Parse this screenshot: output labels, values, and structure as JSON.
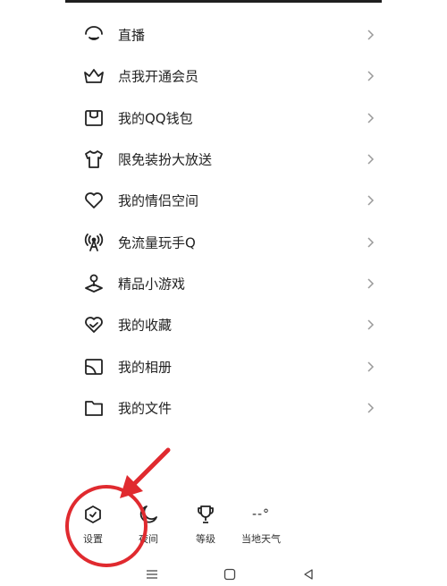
{
  "menu": {
    "items": [
      {
        "label": "直播",
        "icon": "live-icon"
      },
      {
        "label": "点我开通会员",
        "icon": "crown-icon"
      },
      {
        "label": "我的QQ钱包",
        "icon": "wallet-icon"
      },
      {
        "label": "限免装扮大放送",
        "icon": "tshirt-icon"
      },
      {
        "label": "我的情侣空间",
        "icon": "heart-icon"
      },
      {
        "label": "免流量玩手Q",
        "icon": "signal-tower-icon"
      },
      {
        "label": "精品小游戏",
        "icon": "joystick-icon"
      },
      {
        "label": "我的收藏",
        "icon": "favorite-heart-icon"
      },
      {
        "label": "我的相册",
        "icon": "album-icon"
      },
      {
        "label": "我的文件",
        "icon": "folder-icon"
      }
    ]
  },
  "bottombar": {
    "settings_label": "设置",
    "night_label": "夜间",
    "level_label": "等级",
    "weather_label": "当地天气",
    "weather_value": "--°"
  },
  "colors": {
    "annotation": "#e02a2f",
    "text": "#222222",
    "chevron": "#9a9a9a"
  }
}
